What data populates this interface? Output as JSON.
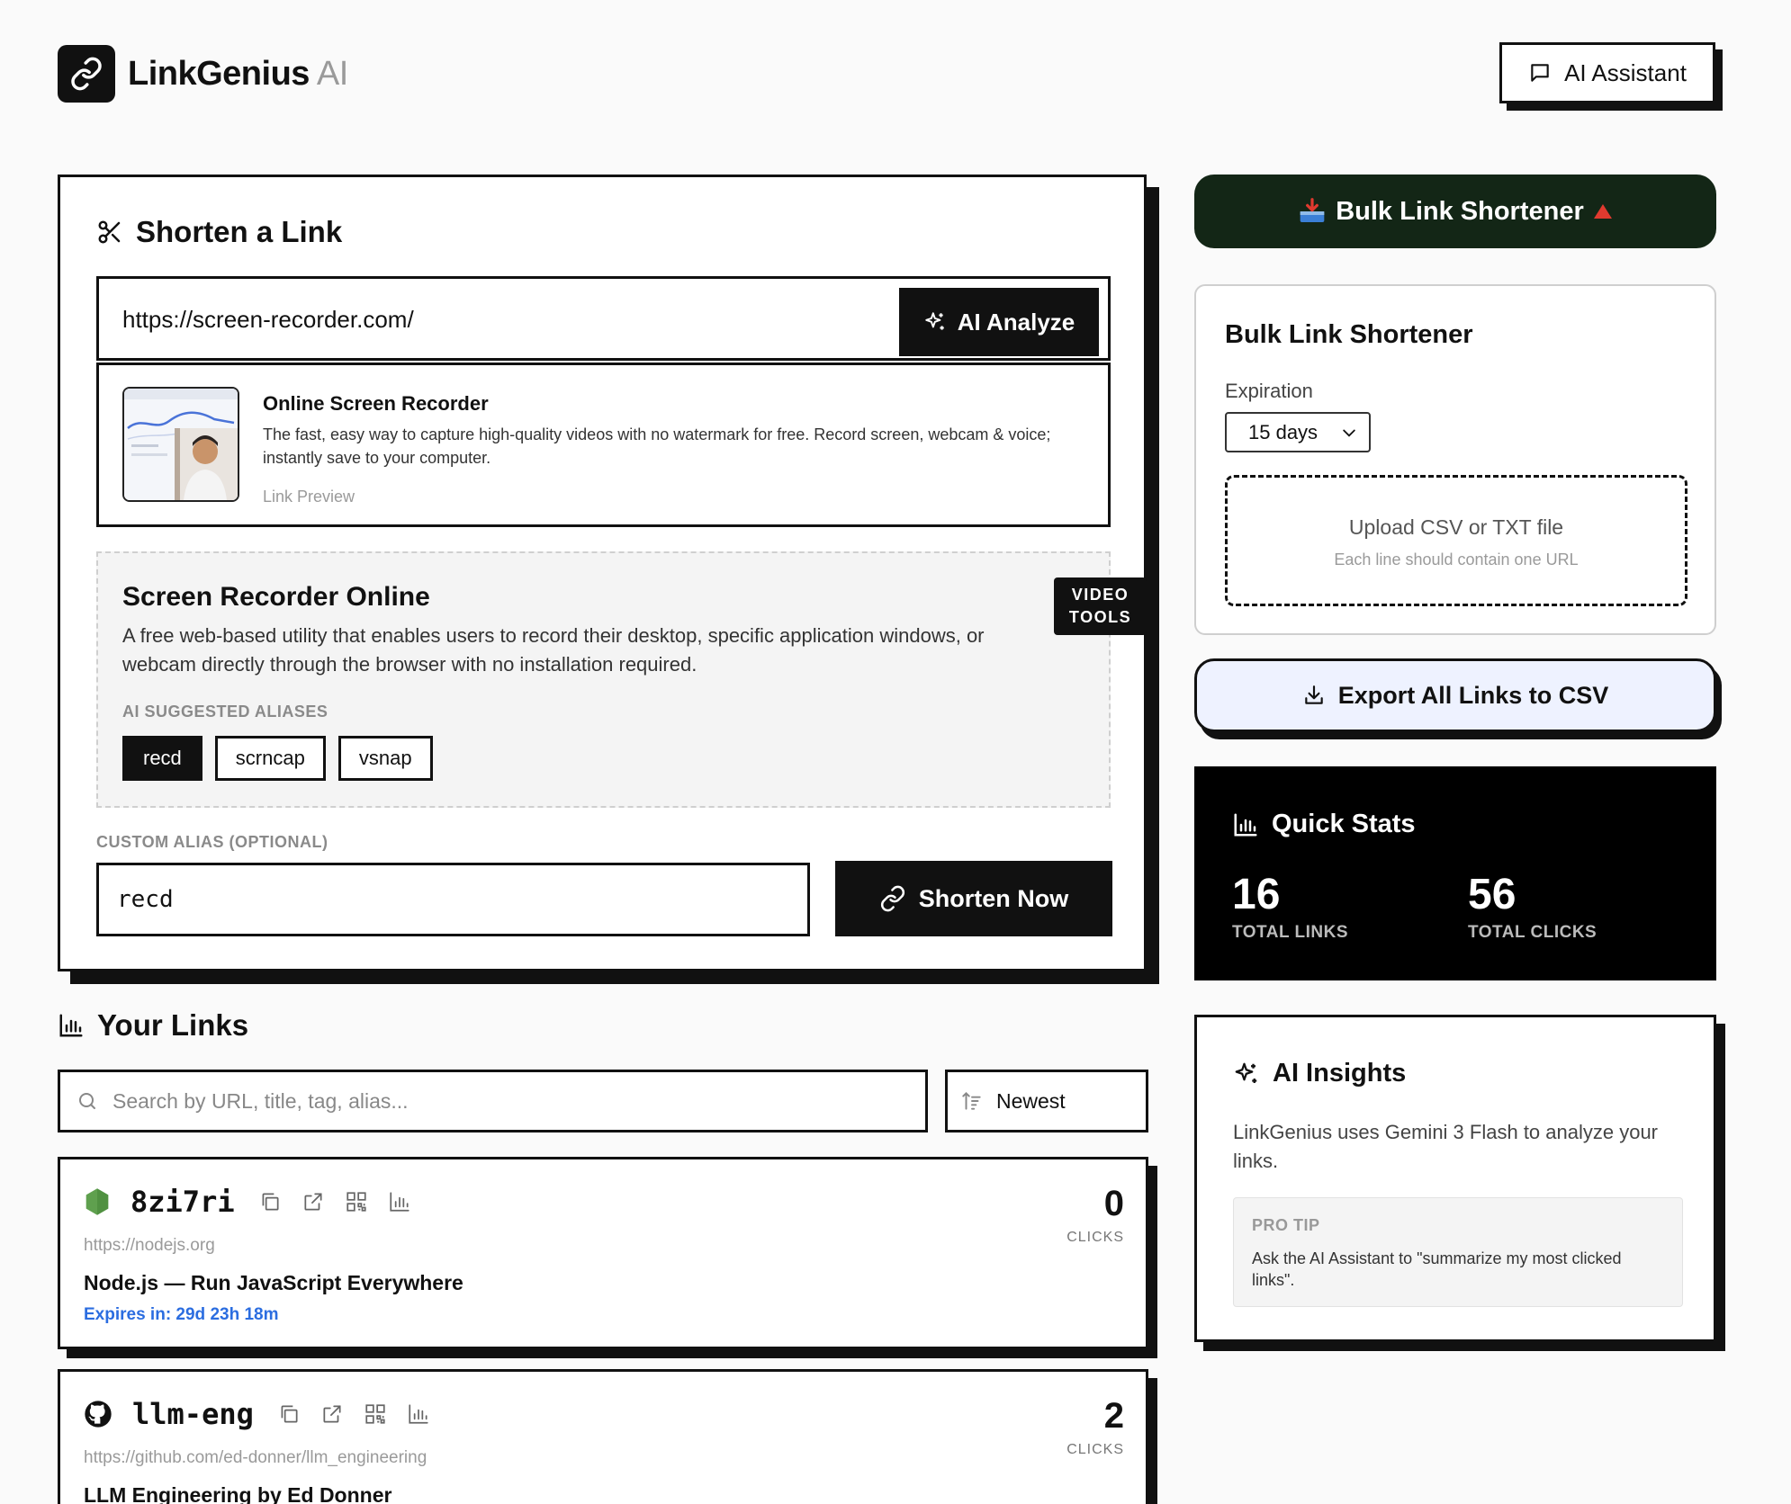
{
  "header": {
    "brand": "LinkGenius",
    "brand_suffix": "AI",
    "assistant_label": "AI Assistant"
  },
  "shorten": {
    "title": "Shorten a Link",
    "url_value": "https://screen-recorder.com/",
    "analyze_label": "AI Analyze",
    "preview": {
      "title": "Online Screen Recorder",
      "description": "The fast, easy way to capture high-quality videos with no watermark for free. Record screen, webcam & voice; instantly save to your computer.",
      "tag": "Link Preview"
    },
    "ai": {
      "title": "Screen Recorder Online",
      "description": "A free web-based utility that enables users to record their desktop, specific application windows, or webcam directly through the browser with no installation required.",
      "badge_line1": "VIDEO",
      "badge_line2": "TOOLS",
      "aliases_label": "AI SUGGESTED ALIASES",
      "aliases": [
        "recd",
        "scrncap",
        "vsnap"
      ]
    },
    "custom_alias_label": "CUSTOM ALIAS (OPTIONAL)",
    "custom_alias_value": "recd",
    "shorten_label": "Shorten Now"
  },
  "links_section": {
    "title": "Your Links",
    "search_placeholder": "Search by URL, title, tag, alias...",
    "sort_label": "Newest",
    "links": [
      {
        "alias": "8zi7ri",
        "url": "https://nodejs.org",
        "title": "Node.js — Run JavaScript Everywhere",
        "expires": "Expires in: 29d 23h 18m",
        "clicks": "0",
        "clicks_label": "CLICKS",
        "favicon": "nodejs-icon"
      },
      {
        "alias": "llm-eng",
        "url": "https://github.com/ed-donner/llm_engineering",
        "title": "LLM Engineering by Ed Donner",
        "clicks": "2",
        "clicks_label": "CLICKS",
        "favicon": "github-icon"
      }
    ]
  },
  "bulk": {
    "button_label": "Bulk Link Shortener",
    "card_title": "Bulk Link Shortener",
    "expiration_label": "Expiration",
    "expiration_value": "15 days",
    "upload_title": "Upload CSV or TXT file",
    "upload_hint": "Each line should contain one URL"
  },
  "export_label": "Export All Links to CSV",
  "stats": {
    "title": "Quick Stats",
    "total_links": "16",
    "total_links_label": "TOTAL LINKS",
    "total_clicks": "56",
    "total_clicks_label": "TOTAL CLICKS"
  },
  "insights": {
    "title": "AI Insights",
    "description": "LinkGenius uses Gemini 3 Flash to analyze your links.",
    "tip_label": "PRO TIP",
    "tip_text": "Ask the AI Assistant to \"summarize my most clicked links\"."
  },
  "colors": {
    "accent_dark_green": "#132616",
    "link_blue": "#2b6de0",
    "export_bg": "#eef2ff",
    "nodejs_green": "#5fa04e"
  }
}
